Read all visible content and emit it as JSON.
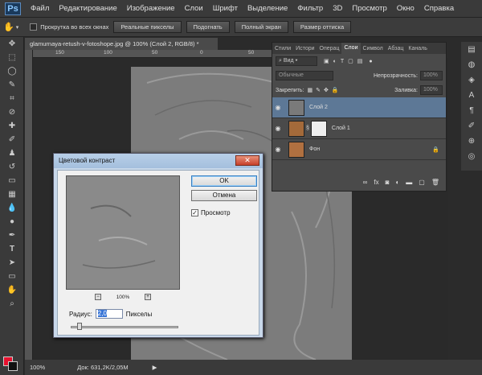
{
  "app": {
    "logo": "Ps"
  },
  "menu": [
    "Файл",
    "Редактирование",
    "Изображение",
    "Слои",
    "Шрифт",
    "Выделение",
    "Фильтр",
    "3D",
    "Просмотр",
    "Окно",
    "Справка"
  ],
  "options": {
    "scroll_all_label": "Прокрутка во всех окнах",
    "buttons": [
      "Реальные пикселы",
      "Подогнать",
      "Полный экран",
      "Размер оттиска"
    ]
  },
  "document": {
    "tab_title": "glamurnaya-retush-v-fotoshope.jpg @ 100% (Слой 2, RGB/8) *",
    "ruler_h": [
      "150",
      "100",
      "50",
      "0",
      "50"
    ],
    "zoom": "100%",
    "status": "Док: 631,2K/2,05M"
  },
  "layers_panel": {
    "tabs": [
      "Стили",
      "Истори",
      "Операц",
      "Слои",
      "Символ",
      "Абзац",
      "Каналь"
    ],
    "active_tab": "Слои",
    "kind_label": "Вид",
    "blend_mode": "Обычные",
    "opacity_label": "Непрозрачность:",
    "opacity_value": "100%",
    "lock_label": "Закрепить:",
    "fill_label": "Заливка:",
    "fill_value": "100%",
    "layers": [
      {
        "name": "Слой 2",
        "selected": true
      },
      {
        "name": "Слой 1",
        "selected": false
      },
      {
        "name": "Фон",
        "selected": false
      }
    ]
  },
  "dialog": {
    "title": "Цветовой контраст",
    "ok_label": "OK",
    "cancel_label": "Отмена",
    "preview_label": "Просмотр",
    "preview_checked": true,
    "zoom_value": "100%",
    "radius_label": "Радиус:",
    "radius_value": "2,0",
    "radius_unit": "Пикселы"
  },
  "colors": {
    "foreground": "#e8102e",
    "background": "#111111",
    "selection": "#5d7896"
  }
}
